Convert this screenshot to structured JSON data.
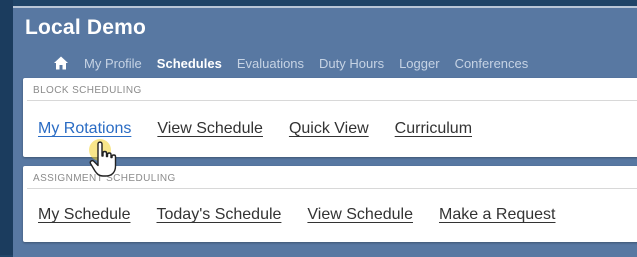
{
  "app": {
    "title": "Local Demo"
  },
  "nav": {
    "home_icon": "home-icon",
    "items": [
      {
        "label": "My Profile",
        "active": false
      },
      {
        "label": "Schedules",
        "active": true
      },
      {
        "label": "Evaluations",
        "active": false
      },
      {
        "label": "Duty Hours",
        "active": false
      },
      {
        "label": "Logger",
        "active": false
      },
      {
        "label": "Conferences",
        "active": false
      }
    ]
  },
  "block_scheduling": {
    "heading": "BLOCK SCHEDULING",
    "links": [
      "My Rotations",
      "View Schedule",
      "Quick View",
      "Curriculum"
    ]
  },
  "assignment_scheduling": {
    "heading": "ASSIGNMENT SCHEDULING",
    "links": [
      "My Schedule",
      "Today's Schedule",
      "View Schedule",
      "Make a Request"
    ]
  },
  "colors": {
    "header_bg": "#5878a2",
    "page_bg": "#1f4468",
    "link_active": "#2a6cc4",
    "cursor_highlight": "#f2d12a"
  }
}
